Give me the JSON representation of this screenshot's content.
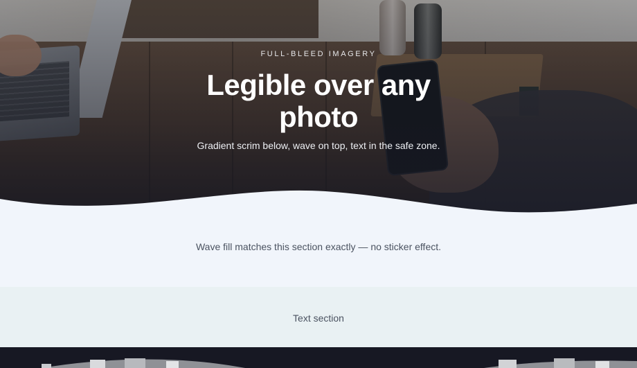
{
  "hero": {
    "eyebrow": "FULL-BLEED IMAGERY",
    "headline": "Legible over any photo",
    "subline": "Gradient scrim below, wave on top, text in the safe zone."
  },
  "section_wave": {
    "text": "Wave fill matches this section exactly — no sticker effect."
  },
  "section_text": {
    "text": "Text section"
  },
  "colors": {
    "section_wave_bg": "#f1f5fb",
    "section_text_bg": "#e9f1f3",
    "dark_section_bg": "#171823"
  }
}
